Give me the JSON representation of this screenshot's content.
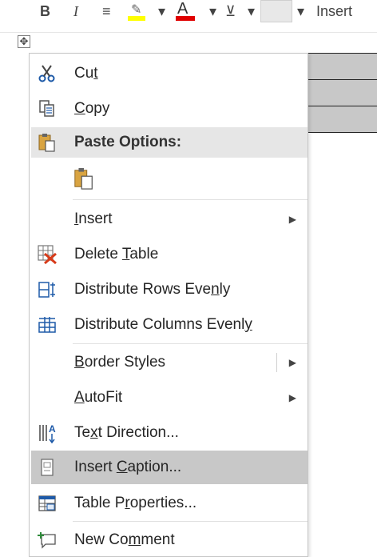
{
  "toolbar": {
    "bold": "B",
    "italic": "I",
    "font_color_letter": "A",
    "insert_label": "Insert",
    "dropdown_glyph": "▾",
    "align_glyph": "≡",
    "shade_glyph": "⊻"
  },
  "table_handle_glyph": "✥",
  "menu": {
    "cut": {
      "pre": "Cu",
      "key": "t",
      "post": ""
    },
    "copy": {
      "pre": "",
      "key": "C",
      "post": "opy"
    },
    "paste_options": "Paste Options:",
    "insert": {
      "pre": "",
      "key": "I",
      "post": "nsert"
    },
    "delete_table": {
      "pre": "Delete ",
      "key": "T",
      "post": "able"
    },
    "distribute_rows": {
      "pre": "Distribute Rows Eve",
      "key": "n",
      "post": "ly"
    },
    "distribute_columns": {
      "pre": "Distribute Columns Evenl",
      "key": "y",
      "post": ""
    },
    "border_styles": {
      "pre": "",
      "key": "B",
      "post": "order Styles"
    },
    "autofit": {
      "pre": "",
      "key": "A",
      "post": "utoFit"
    },
    "text_direction": {
      "pre": "Te",
      "key": "x",
      "post": "t Direction..."
    },
    "insert_caption": {
      "pre": "Insert ",
      "key": "C",
      "post": "aption..."
    },
    "table_properties": {
      "pre": "Table P",
      "key": "r",
      "post": "operties..."
    },
    "new_comment": {
      "pre": "New Co",
      "key": "m",
      "post": "ment"
    },
    "submenu_arrow": "▶"
  },
  "colors": {
    "highlight": "#ffff00",
    "font_color": "#e00000",
    "menu_hover": "#c8c8c8"
  }
}
